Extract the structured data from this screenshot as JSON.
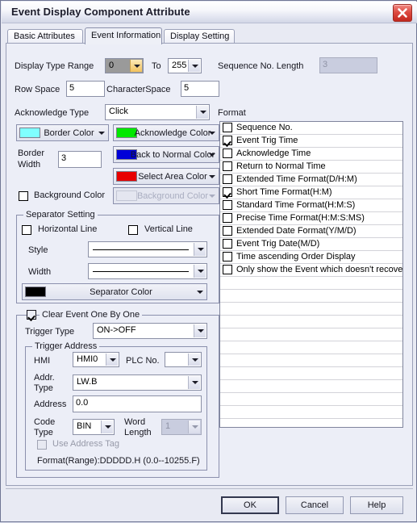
{
  "window": {
    "title": "Event Display Component Attribute",
    "close_icon": "close-icon"
  },
  "tabs": [
    {
      "label": "Basic Attributes",
      "active": false
    },
    {
      "label": "Event Information",
      "active": true
    },
    {
      "label": "Display Setting",
      "active": false
    }
  ],
  "event_information": {
    "display_type_range": {
      "label": "Display Type Range",
      "from_value": "0",
      "to_label": "To",
      "to_value": "255"
    },
    "sequence_no_length": {
      "label": "Sequence No. Length",
      "value": "3",
      "enabled": false
    },
    "row_space": {
      "label": "Row Space",
      "value": "5"
    },
    "character_space": {
      "label": "CharacterSpace",
      "value": "5"
    },
    "acknowledge_type": {
      "label": "Acknowledge Type",
      "value": "Click"
    },
    "format_label": "Format",
    "colors": {
      "border_color": {
        "label": "Border Color",
        "swatch": "#7FFFFF"
      },
      "acknowledge_color": {
        "label": "Acknowledge Color",
        "swatch": "#00E800"
      },
      "back_to_normal_color": {
        "label": "Back to Normal Color",
        "swatch": "#0000D8"
      },
      "select_area_color": {
        "label": "Select Area Color",
        "swatch": "#E80000"
      },
      "background_color_button": {
        "label": "Background Color",
        "swatch": "#E4E6F0",
        "enabled": false
      }
    },
    "border_width": {
      "label": "Border Width",
      "value": "3"
    },
    "background_color_checkbox": {
      "label": "Background Color",
      "checked": false
    },
    "separator_setting": {
      "title": "Separator Setting",
      "horizontal_line": {
        "label": "Horizontal Line",
        "checked": false
      },
      "vertical_line": {
        "label": "Vertical Line",
        "checked": false
      },
      "style": {
        "label": "Style",
        "value": ""
      },
      "width": {
        "label": "Width",
        "value": ""
      },
      "separator_color": {
        "label": "Separator Color",
        "swatch": "#000000"
      }
    },
    "clear_event": {
      "title": "Clear Event One By One",
      "checked": true,
      "trigger_type": {
        "label": "Trigger Type",
        "value": "ON->OFF"
      },
      "trigger_address": {
        "title": "Trigger Address",
        "hmi": {
          "label": "HMI",
          "value": "HMI0"
        },
        "plc_no": {
          "label": "PLC No.",
          "value": ""
        },
        "addr_type": {
          "label": "Addr. Type",
          "value": "LW.B"
        },
        "address": {
          "label": "Address",
          "value": "0.0"
        },
        "code_type": {
          "label": "Code Type",
          "value": "BIN"
        },
        "word_length": {
          "label": "Word Length",
          "value": "1",
          "enabled": false
        },
        "use_address_tag": {
          "label": "Use Address Tag",
          "checked": false,
          "enabled": false
        },
        "format_range": "Format(Range):DDDDD.H (0.0--10255.F)"
      }
    },
    "format_options": [
      {
        "label": "Sequence No.",
        "checked": false
      },
      {
        "label": "Event Trig Time",
        "checked": true
      },
      {
        "label": "Acknowledge Time",
        "checked": false
      },
      {
        "label": "Return to Normal Time",
        "checked": false
      },
      {
        "label": "Extended Time Format(D/H:M)",
        "checked": false
      },
      {
        "label": "Short Time Format(H:M)",
        "checked": true
      },
      {
        "label": "Standard Time Format(H:M:S)",
        "checked": false
      },
      {
        "label": "Precise Time Format(H:M:S:MS)",
        "checked": false
      },
      {
        "label": "Extended Date Format(Y/M/D)",
        "checked": false
      },
      {
        "label": "Event Trig Date(M/D)",
        "checked": false
      },
      {
        "label": "Time ascending Order Display",
        "checked": false
      },
      {
        "label": "Only show the Event which doesn't recover",
        "checked": false
      }
    ]
  },
  "footer": {
    "ok": "OK",
    "cancel": "Cancel",
    "help": "Help"
  }
}
